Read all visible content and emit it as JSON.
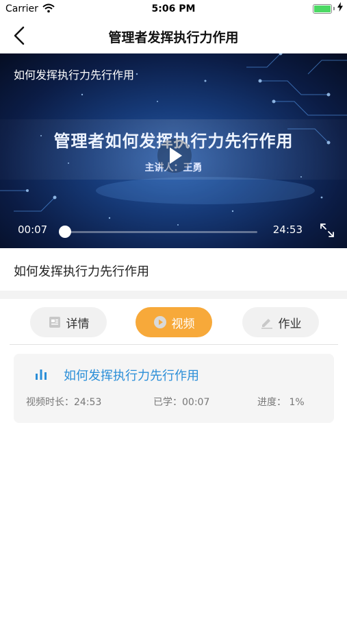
{
  "status_bar": {
    "carrier": "Carrier",
    "time": "5:06 PM"
  },
  "nav": {
    "title": "管理者发挥执行力作用",
    "back_icon": "chevron-left-icon"
  },
  "video": {
    "overlay_title": "如何发挥执行力先行作用",
    "slide_title": "管理者如何发挥执行力先行作用",
    "speaker": "主讲人：王勇",
    "current_time": "00:07",
    "total_time": "24:53",
    "progress_fraction": 0.005
  },
  "lesson_title": "如何发挥执行力先行作用",
  "tabs": [
    {
      "label": "详情",
      "icon": "document-icon",
      "active": false
    },
    {
      "label": "视频",
      "icon": "play-circle-icon",
      "active": true
    },
    {
      "label": "作业",
      "icon": "pencil-icon",
      "active": false
    }
  ],
  "video_item": {
    "title": "如何发挥执行力先行作用",
    "duration": "视频时长：24:53",
    "studied": "已学：00:07",
    "progress": "进度：  1%"
  },
  "colors": {
    "accent": "#f7a93a",
    "link": "#2a8ed8"
  }
}
